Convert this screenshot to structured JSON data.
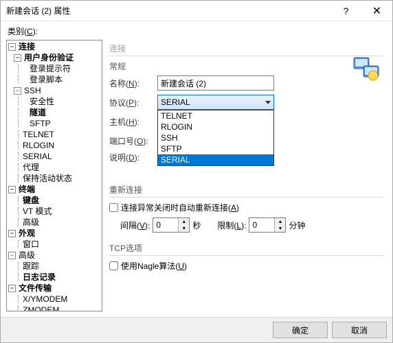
{
  "titlebar": {
    "title": "新建会话 (2) 属性"
  },
  "category_label": "类别",
  "category_hotkey": "C",
  "tree": {
    "connection": "连接",
    "auth": "用户身份验证",
    "login_prompt": "登录提示符",
    "login_script": "登录脚本",
    "ssh": "SSH",
    "security": "安全性",
    "tunnel": "隧道",
    "sftp": "SFTP",
    "telnet": "TELNET",
    "rlogin": "RLOGIN",
    "serial": "SERIAL",
    "proxy": "代理",
    "keep_alive": "保持活动状态",
    "terminal": "终端",
    "keyboard": "键盘",
    "vt_mode": "VT 模式",
    "advanced_term": "高级",
    "appearance": "外观",
    "window": "窗口",
    "advanced": "高级",
    "trace": "跟踪",
    "log": "日志记录",
    "file_transfer": "文件传输",
    "xymodem": "X/YMODEM",
    "zmodem": "ZMODEM"
  },
  "right": {
    "section_connection": "连接",
    "general": "常规",
    "name_label": "名称",
    "name_hotkey": "N",
    "name_value": "新建会话 (2)",
    "protocol_label": "协议",
    "protocol_hotkey": "P",
    "protocol_value": "SERIAL",
    "protocol_options": [
      "TELNET",
      "RLOGIN",
      "SSH",
      "SFTP",
      "SERIAL"
    ],
    "host_label": "主机",
    "host_hotkey": "H",
    "port_label": "端口号",
    "port_hotkey": "O",
    "desc_label": "说明",
    "desc_hotkey": "D",
    "reconnect": "重新连接",
    "auto_reconnect": "连接异常关闭时自动重新连接",
    "auto_reconnect_hotkey": "A",
    "interval_label": "间隔",
    "interval_hotkey": "V",
    "interval_value": "0",
    "interval_unit": "秒",
    "limit_label": "限制",
    "limit_hotkey": "L",
    "limit_value": "0",
    "limit_unit": "分钟",
    "tcp_options": "TCP选项",
    "use_nagle": "使用Nagle算法",
    "use_nagle_hotkey": "U"
  },
  "buttons": {
    "ok": "确定",
    "cancel": "取消"
  }
}
